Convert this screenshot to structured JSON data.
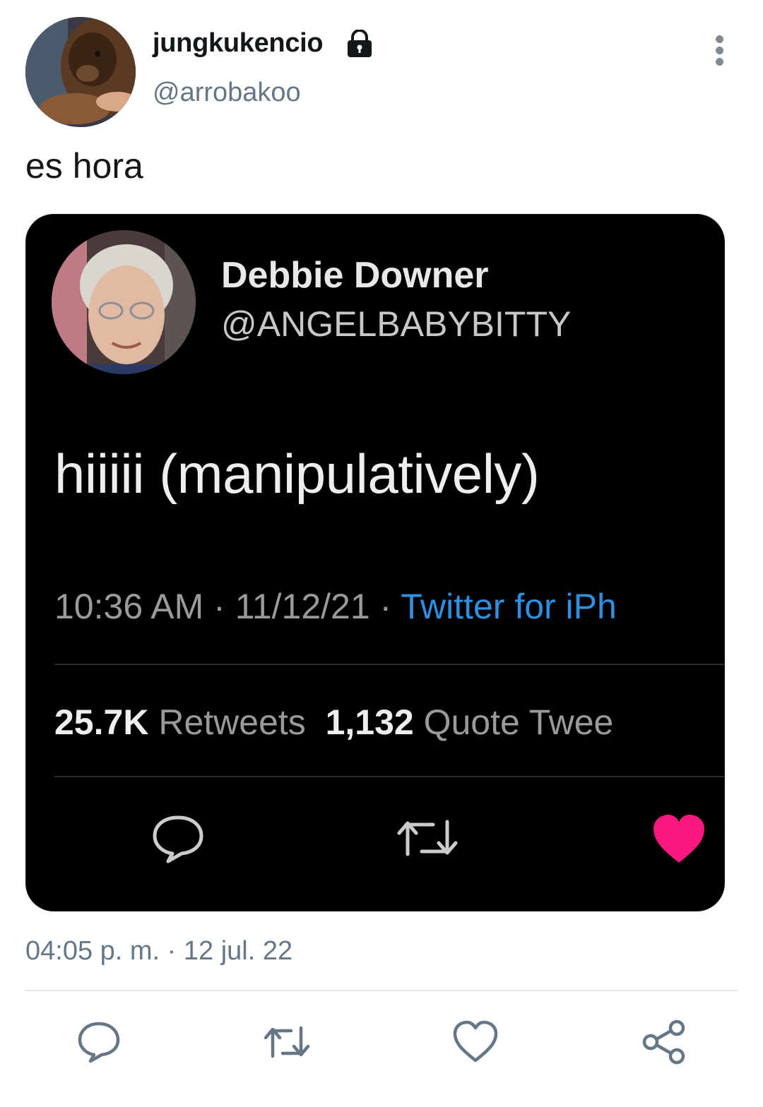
{
  "author": {
    "display_name": "jungkukencio",
    "handle": "@arrobakoo",
    "protected_icon": "lock-icon",
    "avatar": "dog-avatar"
  },
  "tweet": {
    "text": "es hora",
    "timestamp": "04:05 p. m. · 12 jul. 22"
  },
  "embedded_screenshot": {
    "name": "Debbie Downer",
    "handle": "@ANGELBABYBITTY",
    "text": "hiiiii (manipulatively)",
    "time": "10:36 AM",
    "date": "11/12/21",
    "source": "Twitter for iPh",
    "retweets_count": "25.7K",
    "retweets_label": "Retweets",
    "quotes_count": "1,132",
    "quotes_label": "Quote Twee",
    "like_color": "#f91880"
  },
  "actions": [
    {
      "name": "reply",
      "icon": "reply-icon"
    },
    {
      "name": "retweet",
      "icon": "retweet-icon"
    },
    {
      "name": "like",
      "icon": "heart-icon"
    },
    {
      "name": "share",
      "icon": "share-icon"
    }
  ],
  "colors": {
    "text_primary": "#14171a",
    "text_secondary": "#657786",
    "divider": "#e1e8ed"
  }
}
